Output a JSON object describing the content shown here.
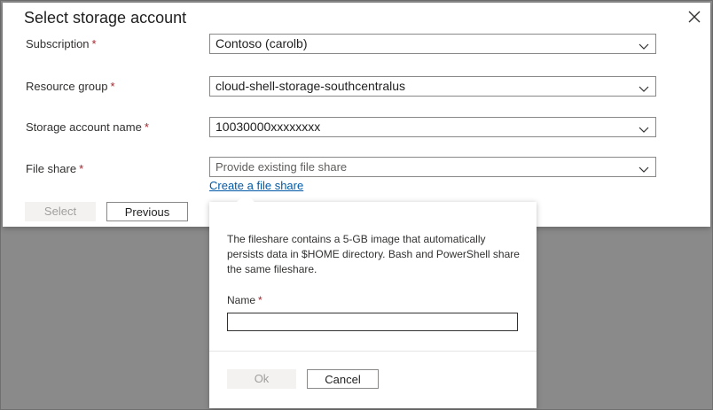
{
  "dialog": {
    "title": "Select storage account",
    "fields": {
      "subscription": {
        "label": "Subscription",
        "value": "Contoso (carolb)"
      },
      "resource_group": {
        "label": "Resource group",
        "value": "cloud-shell-storage-southcentralus"
      },
      "storage_account": {
        "label": "Storage account name",
        "value": "10030000xxxxxxxx"
      },
      "file_share": {
        "label": "File share",
        "placeholder": "Provide existing file share"
      }
    },
    "required_marker": "*",
    "create_link": "Create a file share",
    "buttons": {
      "select": "Select",
      "previous": "Previous"
    }
  },
  "popup": {
    "description": "The fileshare contains a 5-GB image that automatically persists data in $HOME directory. Bash and PowerShell share the same fileshare.",
    "name_label": "Name",
    "name_value": "",
    "buttons": {
      "ok": "Ok",
      "cancel": "Cancel"
    }
  },
  "icons": {
    "close": "close-icon",
    "dropdown": "chevron-down-icon"
  },
  "colors": {
    "link": "#0058a6",
    "required": "#a4262c",
    "overlay": "#8a8a8a"
  }
}
